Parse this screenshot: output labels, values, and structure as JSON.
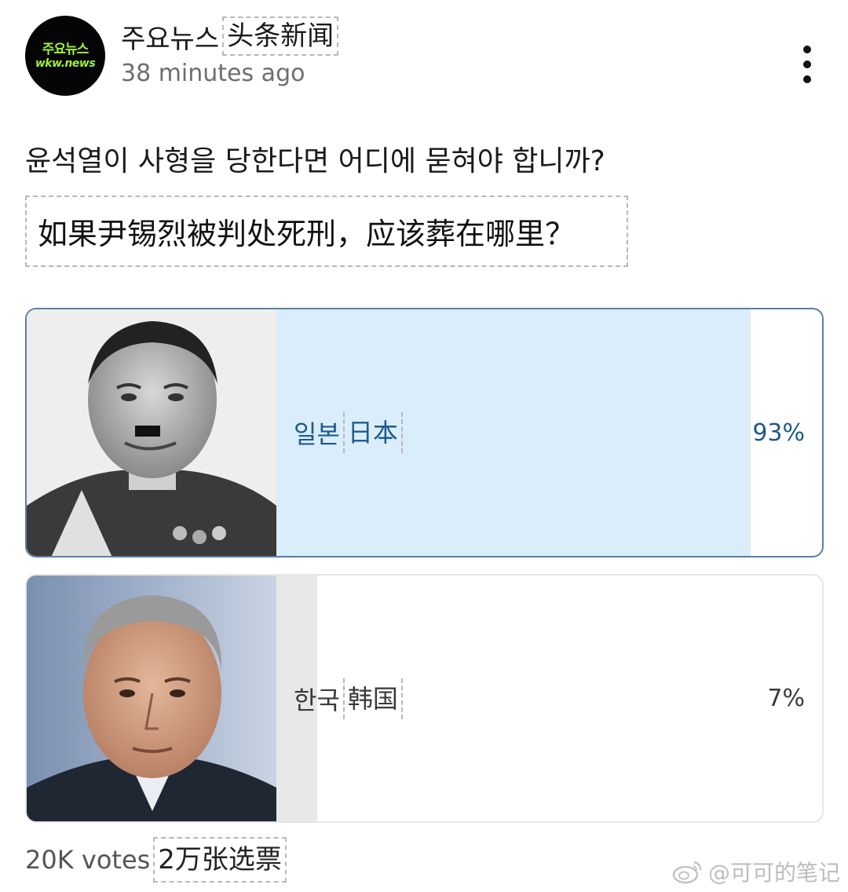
{
  "post": {
    "author": {
      "avatar_line1": "주요뉴스",
      "avatar_line2": "wkw.news",
      "name": "주요뉴스",
      "name_translation": "头条新闻"
    },
    "timestamp": "38 minutes ago",
    "more_icon": "more-vertical-icon",
    "question": "윤석열이 사형을 당한다면 어디에 묻혀야 합니까?",
    "question_translation": "如果尹锡烈被判处死刑，应该葬在哪里？"
  },
  "poll": {
    "options": [
      {
        "label": "일본",
        "translation": "日本",
        "percent_text": "93%",
        "percent": 93,
        "selected": true,
        "bar_color": "#daedfa",
        "text_color": "#1e5a8a",
        "border_color": "#5b80a5"
      },
      {
        "label": "한국",
        "translation": "韩国",
        "percent_text": "7%",
        "percent": 7,
        "selected": false,
        "bar_color": "#e8e8e8",
        "text_color": "#3a3a3a",
        "border_color": "#e6e6e6"
      }
    ],
    "votes": "20K votes",
    "votes_translation": "2万张选票"
  },
  "watermark": {
    "text": "@可可的笔记",
    "icon": "weibo-icon"
  }
}
